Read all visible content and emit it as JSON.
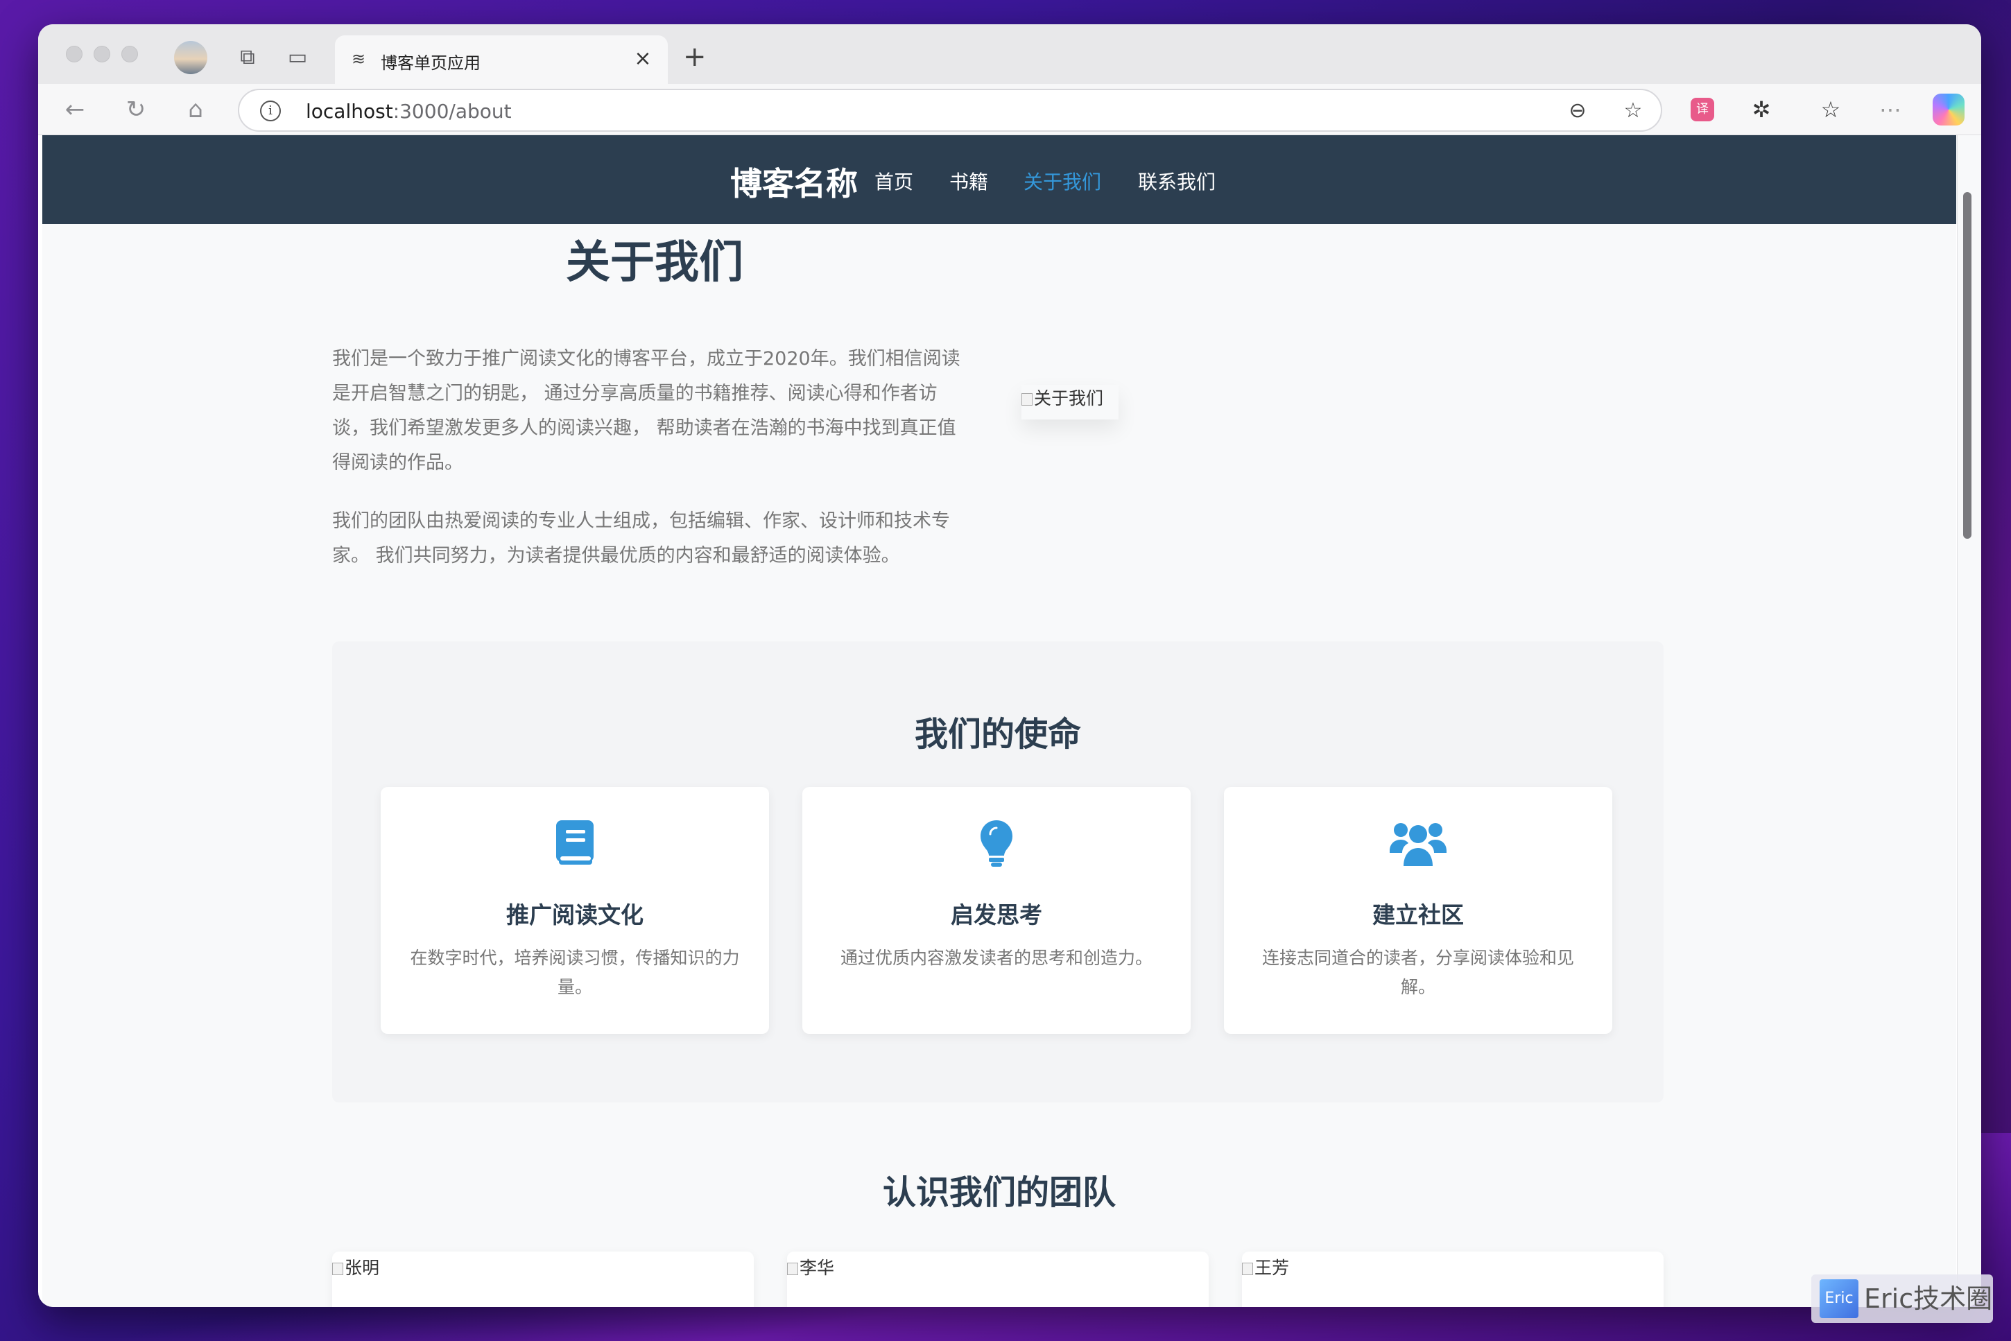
{
  "browser": {
    "tab_title": "博客单页应用",
    "url_host": "localhost",
    "url_path": ":3000/about"
  },
  "site": {
    "brand": "博客名称",
    "nav": [
      "首页",
      "书籍",
      "关于我们",
      "联系我们"
    ],
    "active_nav": "关于我们"
  },
  "about": {
    "title": "关于我们",
    "paragraphs": [
      "我们是一个致力于推广阅读文化的博客平台，成立于2020年。我们相信阅读是开启智慧之门的钥匙， 通过分享高质量的书籍推荐、阅读心得和作者访谈，我们希望激发更多人的阅读兴趣， 帮助读者在浩瀚的书海中找到真正值得阅读的作品。",
      "我们的团队由热爱阅读的专业人士组成，包括编辑、作家、设计师和技术专家。 我们共同努力，为读者提供最优质的内容和最舒适的阅读体验。"
    ],
    "image_alt": "关于我们"
  },
  "mission": {
    "title": "我们的使命",
    "cards": [
      {
        "icon": "book-icon",
        "title": "推广阅读文化",
        "desc": "在数字时代，培养阅读习惯，传播知识的力量。"
      },
      {
        "icon": "lightbulb-icon",
        "title": "启发思考",
        "desc": "通过优质内容激发读者的思考和创造力。"
      },
      {
        "icon": "users-icon",
        "title": "建立社区",
        "desc": "连接志同道合的读者，分享阅读体验和见解。"
      }
    ]
  },
  "team": {
    "title": "认识我们的团队",
    "members": [
      "张明",
      "李华",
      "王芳"
    ]
  },
  "watermark": {
    "logo": "Eric",
    "text": "Eric技术圈"
  },
  "colors": {
    "nav_bg": "#2c3e50",
    "accent": "#3498db",
    "text_dark": "#2c3e50"
  }
}
